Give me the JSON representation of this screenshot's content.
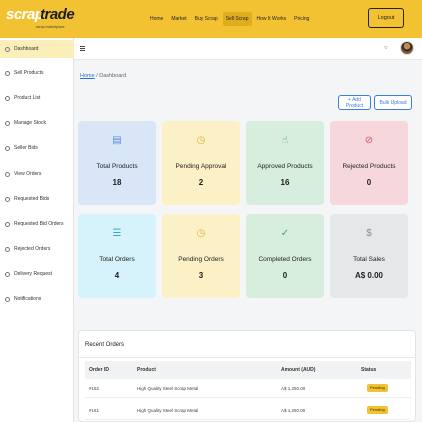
{
  "brand": {
    "part1": "scrap",
    "part2": "trade",
    "tagline": "scrap marketplace"
  },
  "nav": {
    "items": [
      "Home",
      "Market",
      "Buy Scrap",
      "Sell Scrap",
      "How It Works",
      "Pricing"
    ],
    "active": "Sell Scrap"
  },
  "logout_label": "Logout",
  "sidebar": {
    "items": [
      "Dashboard",
      "Sell Products",
      "Product List",
      "Manage Stock",
      "Seller Bids",
      "View Orders",
      "Requested Bids",
      "Requested Bid Orders",
      "Rejected Orders",
      "Delivery Request",
      "Notifications"
    ],
    "active": "Dashboard"
  },
  "breadcrumb": {
    "home": "Home",
    "sep": "/",
    "current": "Dashboard"
  },
  "buttons": {
    "add_product": "+ Add Product",
    "bulk_upload": "Bulk Upload"
  },
  "cards": [
    {
      "label": "Total Products",
      "value": "18",
      "icon": "box-icon"
    },
    {
      "label": "Pending Approval",
      "value": "2",
      "icon": "clock-icon"
    },
    {
      "label": "Approved Products",
      "value": "16",
      "icon": "thumbs-up-icon"
    },
    {
      "label": "Rejected Products",
      "value": "0",
      "icon": "x-circle-icon"
    },
    {
      "label": "Total Orders",
      "value": "4",
      "icon": "list-icon"
    },
    {
      "label": "Pending Orders",
      "value": "3",
      "icon": "clock-icon"
    },
    {
      "label": "Completed Orders",
      "value": "0",
      "icon": "check-circle-icon"
    },
    {
      "label": "Total Sales",
      "value": "A$ 0.00",
      "icon": "dollar-icon"
    }
  ],
  "recent_orders": {
    "title": "Recent Orders",
    "columns": [
      "Order ID",
      "Product",
      "Amount (AUD)",
      "Status"
    ],
    "rows": [
      {
        "id": "#162",
        "product": "High Quality Steel Scrap Metal",
        "amount": "A$ 1,250.00",
        "status": "Pending"
      },
      {
        "id": "#161",
        "product": "High Quality Steel Scrap Metal",
        "amount": "A$ 1,250.00",
        "status": "Pending"
      }
    ]
  },
  "colors": {
    "brand_yellow": "#f2c233",
    "link_blue": "#3d7ddb"
  }
}
